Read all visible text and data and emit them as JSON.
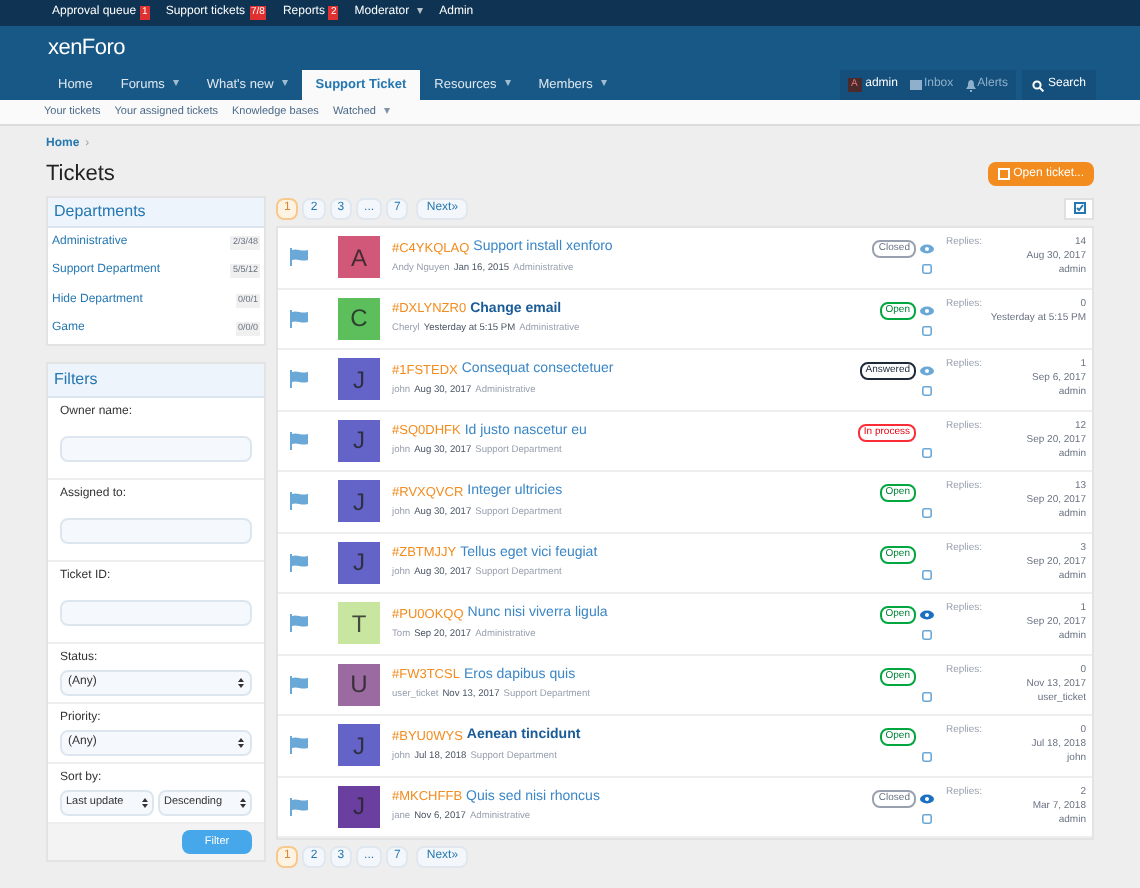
{
  "staff_bar": [
    {
      "label": "Approval queue",
      "badge": "1"
    },
    {
      "label": "Support tickets",
      "badge": "7/8"
    },
    {
      "label": "Reports",
      "badge": "2"
    },
    {
      "label": "Moderator",
      "caret": "▾"
    },
    {
      "label": "Admin"
    }
  ],
  "logo": "xenForo",
  "nav": [
    {
      "label": "Home",
      "selected": false
    },
    {
      "label": "Forums",
      "selected": false,
      "caret": "▾"
    },
    {
      "label": "What's new",
      "selected": false,
      "caret": "▾"
    },
    {
      "label": "Support Ticket",
      "selected": true
    },
    {
      "label": "Resources",
      "selected": false,
      "caret": "▾"
    },
    {
      "label": "Members",
      "selected": false,
      "caret": "▾"
    }
  ],
  "user_nav": {
    "avatar": "A",
    "user": "admin",
    "inbox": "Inbox",
    "alerts": "Alerts",
    "search": "Search"
  },
  "sub_nav": [
    {
      "label": "Your tickets"
    },
    {
      "label": "Your assigned tickets"
    },
    {
      "label": "Knowledge bases"
    },
    {
      "label": "Watched",
      "caret": "▾"
    }
  ],
  "breadcrumb": "Home",
  "breadcrumb_sep": "›",
  "title": "Tickets",
  "open_ticket": "Open ticket...",
  "departments": {
    "title": "Departments",
    "items": [
      {
        "name": "Administrative",
        "count": "2/3/48"
      },
      {
        "name": "Support Department",
        "count": "5/5/12"
      },
      {
        "name": "Hide Department",
        "count": "0/0/1"
      },
      {
        "name": "Game",
        "count": "0/0/0"
      }
    ]
  },
  "filters": {
    "title": "Filters",
    "fields": [
      {
        "kind": "text",
        "label": "Owner name:"
      },
      {
        "kind": "text",
        "label": "Assigned to:"
      },
      {
        "kind": "text",
        "label": "Ticket ID:"
      },
      {
        "kind": "select",
        "label": "Status:",
        "value": "(Any)"
      },
      {
        "kind": "select",
        "label": "Priority:",
        "value": "(Any)"
      },
      {
        "kind": "pair",
        "label": "Sort by:",
        "value": "Last update",
        "value2": "Descending"
      }
    ],
    "button": "Filter"
  },
  "pager_top": {
    "pages": [
      {
        "label": "1",
        "selected": true
      },
      {
        "label": "2",
        "selected": false
      },
      {
        "label": "3",
        "selected": false
      },
      {
        "label": "...",
        "selected": false
      },
      {
        "label": "7",
        "selected": false
      }
    ],
    "next": "Next»"
  },
  "tickets": [
    {
      "avatar": "A",
      "color": "#d2587a",
      "id": "#C4YKQLAQ",
      "title": "Support install xenforo",
      "unread": false,
      "author": "Andy Nguyen",
      "date": "Jan 16, 2015",
      "department": "Administrative",
      "status": "Closed",
      "eye": true,
      "watched": false,
      "checked": false,
      "replies_label": "Replies:",
      "replies": "14",
      "last_date": "Aug 30, 2017",
      "last_user": "admin"
    },
    {
      "avatar": "C",
      "color": "#5cbf5c",
      "id": "#DXLYNZR0",
      "title": "Change email",
      "unread": true,
      "author": "Cheryl",
      "date": "Yesterday at 5:15 PM",
      "department": "Administrative",
      "status": "Open",
      "eye": true,
      "watched": false,
      "checked": false,
      "replies_label": "Replies:",
      "replies": "0",
      "last_date": "Yesterday at 5:15 PM"
    },
    {
      "avatar": "J",
      "color": "#6464c8",
      "id": "#1FSTEDX",
      "title": "Consequat consectetuer",
      "unread": false,
      "author": "john",
      "date": "Aug 30, 2017",
      "department": "Administrative",
      "status": "Answered",
      "eye": true,
      "watched": false,
      "checked": false,
      "replies_label": "Replies:",
      "replies": "1",
      "last_date": "Sep 6, 2017",
      "last_user": "admin"
    },
    {
      "avatar": "J",
      "color": "#6464c8",
      "id": "#SQ0DHFK",
      "title": "Id justo nascetur eu",
      "unread": false,
      "author": "john",
      "date": "Aug 30, 2017",
      "department": "Support Department",
      "status": "In process",
      "eye": false,
      "checked": false,
      "replies_label": "Replies:",
      "replies": "12",
      "last_date": "Sep 20, 2017",
      "last_user": "admin"
    },
    {
      "avatar": "J",
      "color": "#6464c8",
      "id": "#RVXQVCR",
      "title": "Integer ultricies",
      "unread": false,
      "author": "john",
      "date": "Aug 30, 2017",
      "department": "Support Department",
      "status": "Open",
      "eye": false,
      "checked": false,
      "replies_label": "Replies:",
      "replies": "13",
      "last_date": "Sep 20, 2017",
      "last_user": "admin"
    },
    {
      "avatar": "J",
      "color": "#6464c8",
      "id": "#ZBTMJJY",
      "title": "Tellus eget vici feugiat",
      "unread": false,
      "author": "john",
      "date": "Aug 30, 2017",
      "department": "Support Department",
      "status": "Open",
      "eye": false,
      "checked": false,
      "replies_label": "Replies:",
      "replies": "3",
      "last_date": "Sep 20, 2017",
      "last_user": "admin"
    },
    {
      "avatar": "T",
      "color": "#c8e6a0",
      "id": "#PU0OKQQ",
      "title": "Nunc nisi viverra ligula",
      "unread": false,
      "author": "Tom",
      "date": "Sep 20, 2017",
      "department": "Administrative",
      "status": "Open",
      "eye": true,
      "watched": true,
      "checked": false,
      "replies_label": "Replies:",
      "replies": "1",
      "last_date": "Sep 20, 2017",
      "last_user": "admin"
    },
    {
      "avatar": "U",
      "color": "#9a6aa0",
      "id": "#FW3TCSL",
      "title": "Eros dapibus quis",
      "unread": false,
      "author": "user_ticket",
      "date": "Nov 13, 2017",
      "department": "Support Department",
      "status": "Open",
      "eye": false,
      "checked": false,
      "replies_label": "Replies:",
      "replies": "0",
      "last_date": "Nov 13, 2017",
      "last_user": "user_ticket"
    },
    {
      "avatar": "J",
      "color": "#6464c8",
      "id": "#BYU0WYS",
      "title": "Aenean tincidunt",
      "unread": true,
      "author": "john",
      "date": "Jul 18, 2018",
      "department": "Support Department",
      "status": "Open",
      "eye": false,
      "checked": false,
      "replies_label": "Replies:",
      "replies": "0",
      "last_date": "Jul 18, 2018",
      "last_user": "john"
    },
    {
      "avatar": "J",
      "color": "#6a3fa0",
      "id": "#MKCHFFB",
      "title": "Quis sed nisi rhoncus",
      "unread": false,
      "author": "jane",
      "date": "Nov 6, 2017",
      "department": "Administrative",
      "status": "Closed",
      "eye": true,
      "watched": true,
      "checked": false,
      "replies_label": "Replies:",
      "replies": "2",
      "last_date": "Mar 7, 2018",
      "last_user": "admin"
    }
  ],
  "pager_bottom": {
    "pages": [
      {
        "label": "1",
        "selected": true
      },
      {
        "label": "2",
        "selected": false
      },
      {
        "label": "3",
        "selected": false
      },
      {
        "label": "...",
        "selected": false
      },
      {
        "label": "7",
        "selected": false
      }
    ],
    "next": "Next»"
  }
}
